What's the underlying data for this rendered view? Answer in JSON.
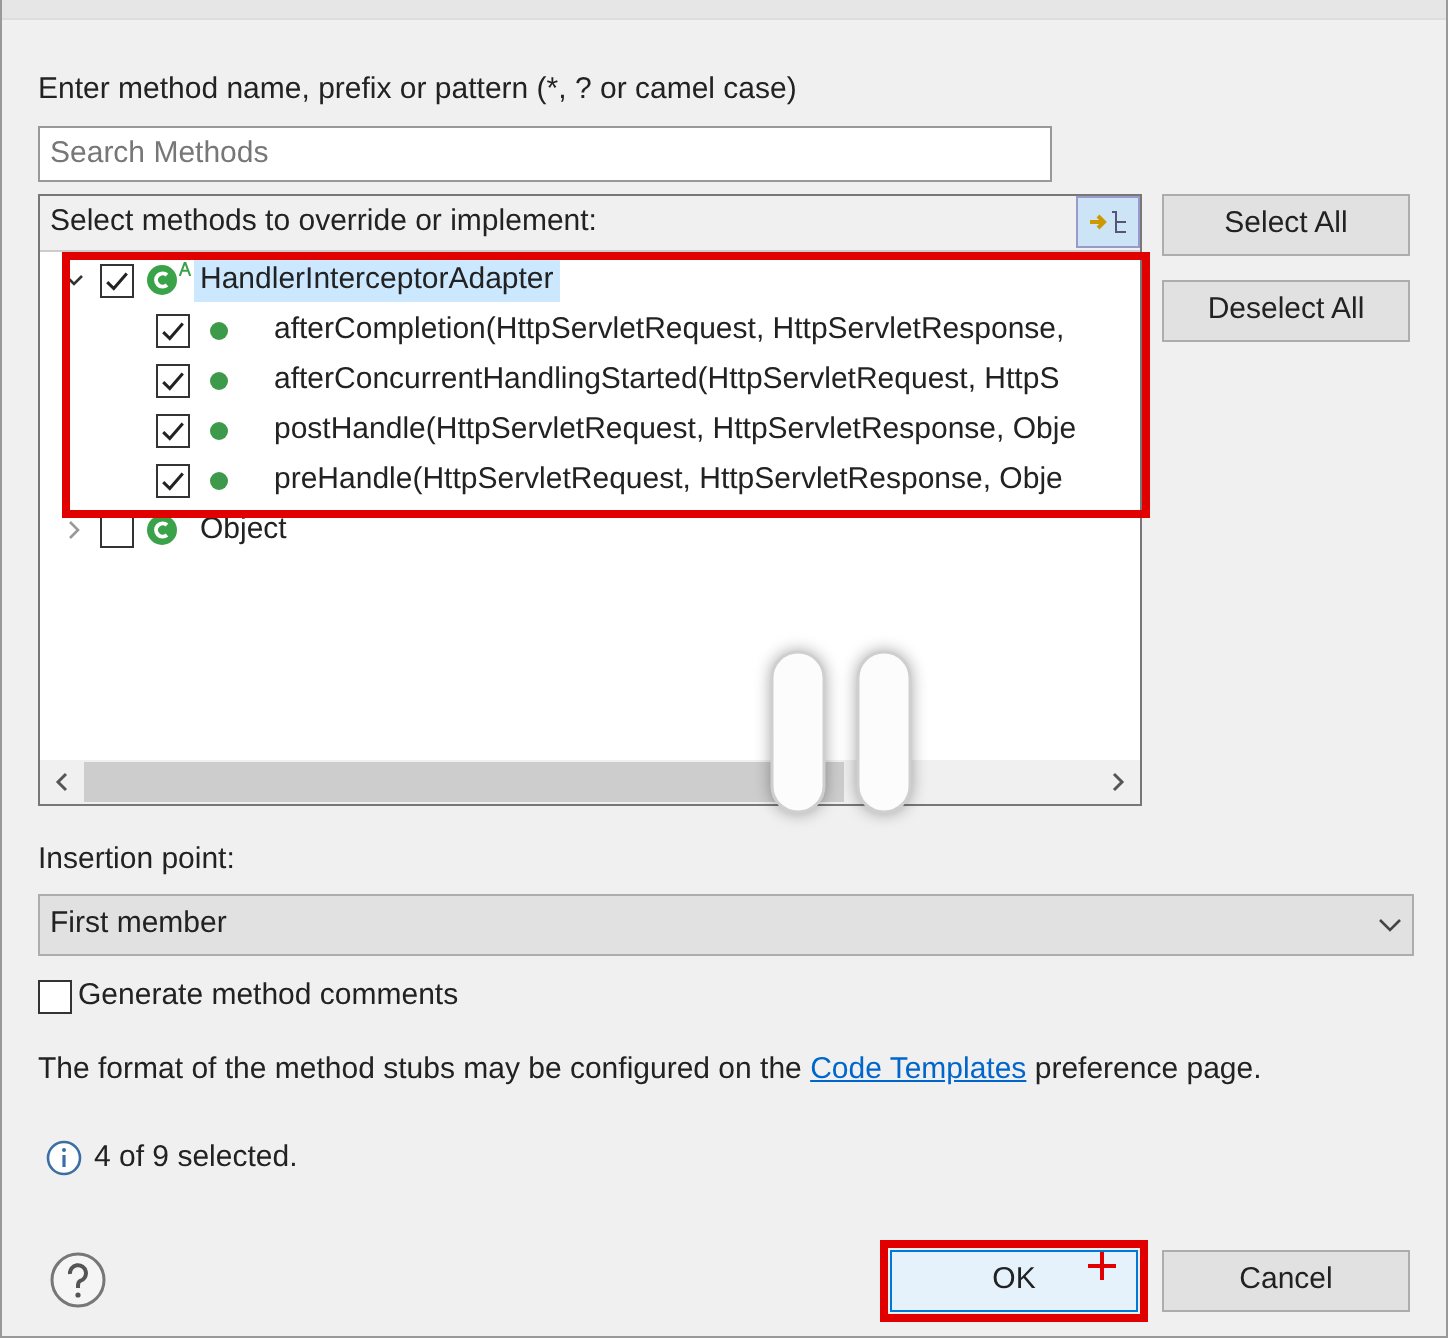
{
  "prompt": "Enter method name, prefix or pattern (*, ? or camel case)",
  "search": {
    "placeholder": "Search Methods"
  },
  "tree": {
    "label": "Select methods to override or implement:",
    "items": [
      {
        "kind": "class",
        "abstract": true,
        "label": "HandlerInterceptorAdapter",
        "checked": true,
        "expanded": true,
        "selected": true,
        "children": [
          {
            "kind": "method",
            "label": "afterCompletion(HttpServletRequest, HttpServletResponse,",
            "checked": true,
            "selected": false
          },
          {
            "kind": "method",
            "label": "afterConcurrentHandlingStarted(HttpServletRequest, HttpS",
            "checked": true,
            "selected": false
          },
          {
            "kind": "method",
            "label": "postHandle(HttpServletRequest, HttpServletResponse, Obje",
            "checked": true,
            "selected": false
          },
          {
            "kind": "method",
            "label": "preHandle(HttpServletRequest, HttpServletResponse, Obje",
            "checked": true,
            "selected": false
          }
        ]
      },
      {
        "kind": "class",
        "abstract": false,
        "label": "Object",
        "checked": false,
        "expanded": false,
        "selected": false
      }
    ]
  },
  "side_buttons": [
    "Select All",
    "Deselect All"
  ],
  "insertion": {
    "label": "Insertion point:",
    "value": "First member"
  },
  "comments": {
    "label": "Generate method comments",
    "checked": false
  },
  "note": {
    "before": "The format of the method stubs may be configured on the ",
    "link": "Code Templates",
    "after": " preference page."
  },
  "status": "4 of 9 selected.",
  "buttons": [
    {
      "label": "OK",
      "highlighted": true
    },
    {
      "label": "Cancel",
      "highlighted": false
    }
  ]
}
